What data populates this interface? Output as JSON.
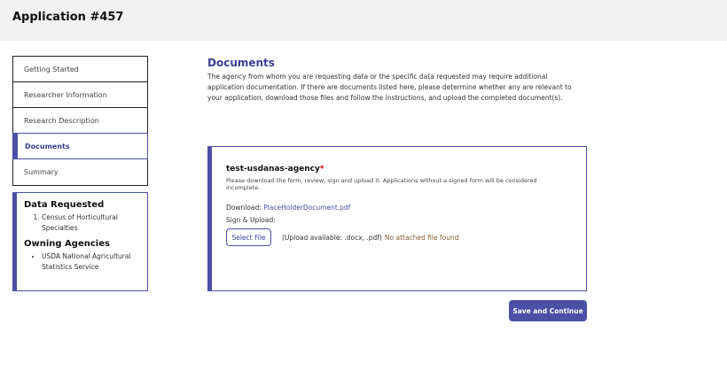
{
  "header": {
    "title": "Application #457"
  },
  "nav": {
    "items": [
      {
        "label": "Getting Started"
      },
      {
        "label": "Researcher Information"
      },
      {
        "label": "Research Description"
      },
      {
        "label": "Documents",
        "active": true
      },
      {
        "label": "Summary"
      }
    ]
  },
  "info": {
    "data_requested_title": "Data Requested",
    "data_requested": [
      "Census of Horticultural Specialties"
    ],
    "owning_agencies_title": "Owning Agencies",
    "owning_agencies": [
      "USDA National Agricultural Statistics Service"
    ]
  },
  "main": {
    "title": "Documents",
    "description": "The agency from whom you are requesting data or the specific data requested may require additional application documentation. If there are documents listed here, please determine whether any are relevant to your application, download those files and follow the instructions, and upload the completed document(s)."
  },
  "document": {
    "agency": "test-usdanas-agency",
    "required_mark": "*",
    "instructions": "Please download the form, review, sign and upload it. Applications without a signed form will be considered incomplete.",
    "download_label": "Download:",
    "download_file": "PlaceHolderDocument.pdf",
    "sign_upload_label": "Sign & Upload:",
    "select_file_label": "Select File",
    "upload_available": "(Upload available: .docx, .pdf)",
    "file_status": "No attached file found"
  },
  "actions": {
    "save_label": "Save and Continue"
  },
  "colors": {
    "accent": "#4b4fa6",
    "header_bg": "#f2f2f2"
  }
}
